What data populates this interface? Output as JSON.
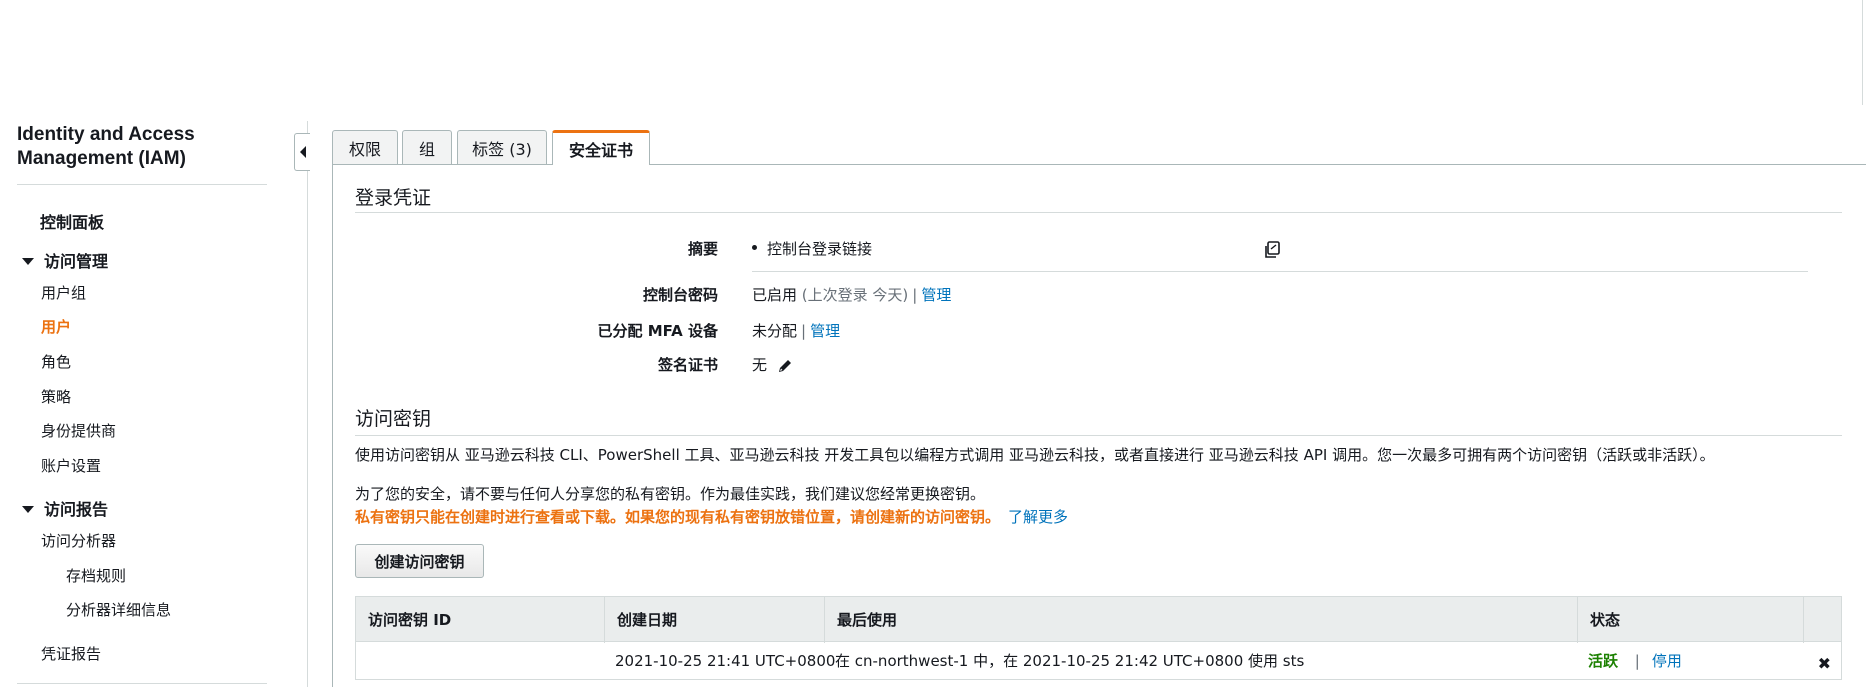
{
  "sidebar": {
    "title": "Identity and Access Management (IAM)",
    "dashboard": "控制面板",
    "access_mgmt": {
      "label": "访问管理",
      "items": [
        "用户组",
        "用户",
        "角色",
        "策略",
        "身份提供商",
        "账户设置"
      ]
    },
    "access_reports": {
      "label": "访问报告",
      "analyzer": "访问分析器",
      "archive_rules": "存档规则",
      "analyzer_details": "分析器详细信息",
      "cred_report": "凭证报告"
    }
  },
  "tabs": [
    "权限",
    "组",
    "标签 (3)",
    "安全证书"
  ],
  "sign_in": {
    "title": "登录凭证",
    "summary_label": "摘要",
    "summary_value": "控制台登录链接",
    "console_pwd_label": "控制台密码",
    "console_pwd_status": "已启用",
    "console_pwd_last": "(上次登录 今天)",
    "manage": "管理",
    "mfa_label": "已分配 MFA 设备",
    "mfa_value": "未分配",
    "cert_label": "签名证书",
    "cert_value": "无"
  },
  "access_keys": {
    "title": "访问密钥",
    "desc": "使用访问密钥从 亚马逊云科技 CLI、PowerShell 工具、亚马逊云科技 开发工具包以编程方式调用 亚马逊云科技，或者直接进行 亚马逊云科技 API 调用。您一次最多可拥有两个访问密钥（活跃或非活跃）。",
    "security_note": "为了您的安全，请不要与任何人分享您的私有密钥。作为最佳实践，我们建议您经常更换密钥。",
    "warning": "私有密钥只能在创建时进行查看或下载。如果您的现有私有密钥放错位置，请创建新的访问密钥。",
    "learn_more": "了解更多",
    "create_button": "创建访问密钥",
    "columns": [
      "访问密钥 ID",
      "创建日期",
      "最后使用",
      "状态"
    ],
    "rows": [
      {
        "key_id": "",
        "created": "2021-10-25 21:41 UTC+0800",
        "last_used": "在 cn-northwest-1 中，在 2021-10-25 21:42 UTC+0800 使用 sts",
        "status": "活跃",
        "action": "停用"
      }
    ]
  },
  "colors": {
    "accent": "#ec7211",
    "link": "#0073bb",
    "active": "#1d8102",
    "border": "#aab7b8"
  }
}
